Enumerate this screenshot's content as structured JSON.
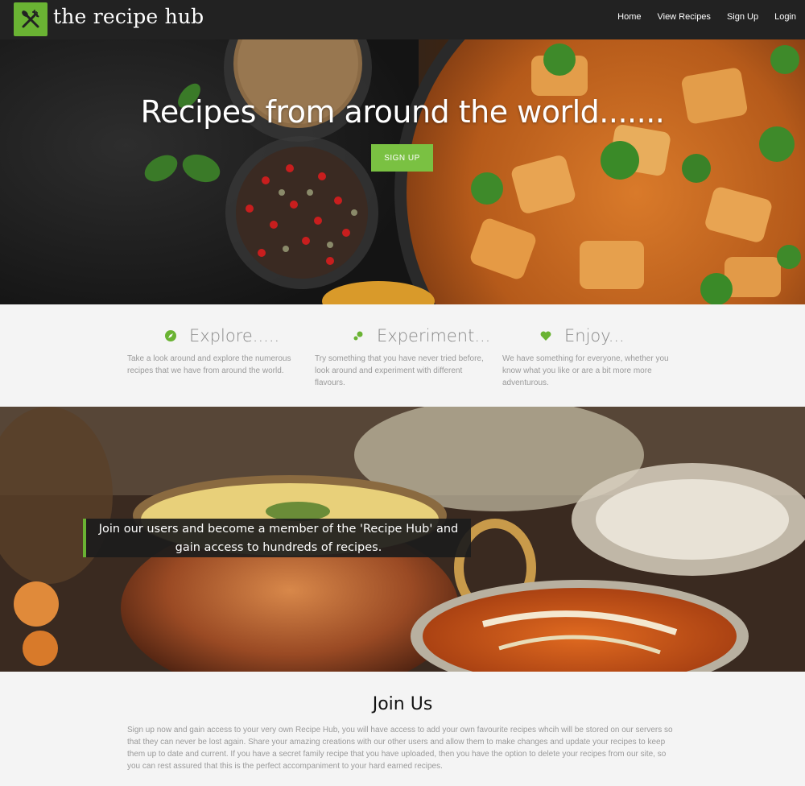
{
  "brand": {
    "name": "the recipe hub",
    "logo_icon": "fork-knife-icon",
    "accent": "#6ab333"
  },
  "nav": {
    "items": [
      "Home",
      "View Recipes",
      "Sign Up",
      "Login"
    ]
  },
  "hero": {
    "title": "Recipes from around the world.......",
    "button": "SIGN UP"
  },
  "features": [
    {
      "icon": "compass-icon",
      "title": "Explore.....",
      "text": "Take a look around and explore the numerous recipes that we have from around the world."
    },
    {
      "icon": "flask-icon",
      "title": "Experiment...",
      "text": "Try something that you have never tried before, look around and experiment with different flavours."
    },
    {
      "icon": "heart-icon",
      "title": "Enjoy...",
      "text": "We have something for everyone, whether you know what you like or are a bit more more adventurous."
    }
  ],
  "banner": {
    "caption": "Join our users and become a member of the 'Recipe Hub' and gain access to hundreds of recipes."
  },
  "join": {
    "title": "Join Us",
    "text": "Sign up now and gain access to your very own Recipe Hub, you will have access to add your own favourite recipes whcih will be stored on our servers so that they can never be lost again. Share your amazing creations with our other users and allow them to make changes and update your recipes to keep them up to date and current. If you have a secret family recipe that you have uploaded, then you have the option to delete your recipes from our site, so you can rest assured that this is the perfect accompaniment to your hard earned recipes."
  }
}
